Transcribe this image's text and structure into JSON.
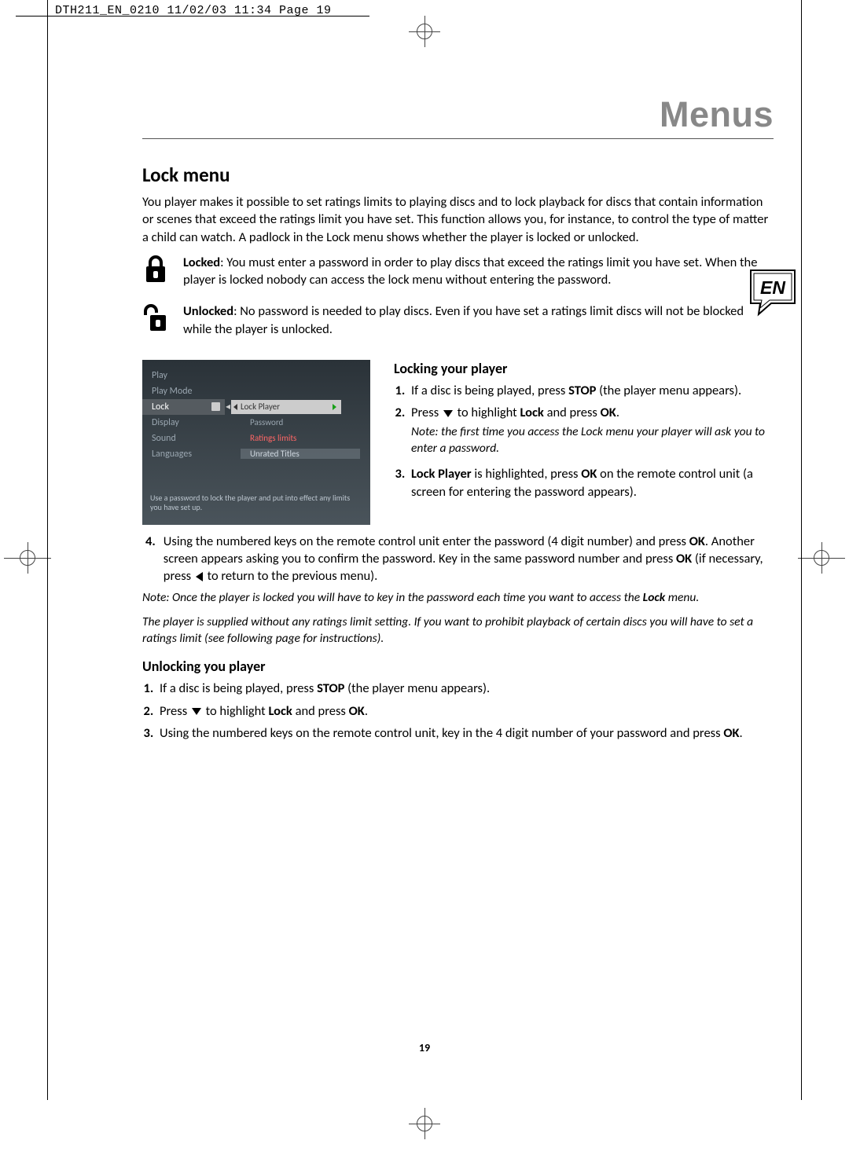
{
  "crop": {
    "header": "DTH211_EN_0210  11/02/03  11:34  Page 19"
  },
  "chapter": "Menus",
  "language_badge": "EN",
  "page_number": "19",
  "lock_menu": {
    "title": "Lock menu",
    "intro": "You player makes it possible to set ratings limits to playing discs and to lock playback for discs that contain information or scenes that exceed the ratings limit you have set. This function allows you, for instance, to control the type of matter a child can watch. A padlock in the Lock menu shows whether the player is locked or unlocked.",
    "locked_label": "Locked",
    "locked_text": ": You must enter a password in order to play discs that exceed the ratings limit you have set. When the player is locked nobody can access the lock menu without entering the password.",
    "unlocked_label": "Unlocked",
    "unlocked_text": ": No password is needed to play discs. Even if you have set a ratings limit discs will not be blocked while the player is unlocked."
  },
  "screenshot": {
    "menu": [
      "Play",
      "Play Mode",
      "Lock",
      "Display",
      "Sound",
      "Languages"
    ],
    "submenu": [
      "Lock Player",
      "Password",
      "Ratings limits",
      "Unrated Titles"
    ],
    "highlight_index": 2,
    "footer": "Use a password to lock the player and put into effect any limits you have set up."
  },
  "locking": {
    "title": "Locking your player",
    "step1a": "If a disc is being played, press ",
    "step1b": "STOP",
    "step1c": " (the player menu appears).",
    "step2a": "Press ",
    "step2b": " to highlight ",
    "step2c": "Lock",
    "step2d": " and press ",
    "step2e": "OK",
    "step2f": ".",
    "note2": "Note: the first time you access the Lock menu your player will ask you to enter a password.",
    "step3a": "Lock Player",
    "step3b": " is highlighted, press ",
    "step3c": "OK",
    "step3d": " on the remote control unit (a screen for entering the password appears).",
    "step4a": "Using the numbered keys on the remote control unit enter the password (4 digit number) and press ",
    "step4b": "OK",
    "step4c": ". Another screen appears asking you to confirm the password. Key in the same password number and press ",
    "step4d": "OK",
    "step4e": " (if necessary, press ",
    "step4f": " to return to the previous menu).",
    "note4a": "Note: Once the player is locked you will have to key in the password each time you want to access the ",
    "note4b": "Lock",
    "note4c": " menu.",
    "note4d": "The player is supplied without any ratings limit setting. If you want to prohibit playback of certain discs you will have to set a ratings limit (see following page for instructions)."
  },
  "unlocking": {
    "title": "Unlocking you player",
    "step1a": "If a disc is being played, press ",
    "step1b": "STOP",
    "step1c": " (the player menu appears).",
    "step2a": "Press ",
    "step2b": " to highlight ",
    "step2c": "Lock",
    "step2d": " and press ",
    "step2e": "OK",
    "step2f": ".",
    "step3": "Using the numbered keys on the remote control unit, key in the 4 digit number of your password and press ",
    "step3b": "OK",
    "step3c": "."
  }
}
